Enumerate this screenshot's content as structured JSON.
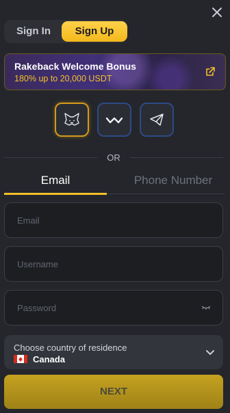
{
  "auth_tabs": {
    "sign_in": "Sign In",
    "sign_up": "Sign Up",
    "active": "Sign Up"
  },
  "bonus": {
    "title": "Rakeback Welcome Bonus",
    "subtitle": "180% up to 20,000 USDT"
  },
  "wallets": [
    "metamask-icon",
    "walletconnect-icon",
    "telegram-icon"
  ],
  "divider": {
    "text": "OR"
  },
  "method_tabs": {
    "email": "Email",
    "phone": "Phone Number",
    "active": "Email"
  },
  "form": {
    "email": {
      "placeholder": "Email",
      "value": ""
    },
    "username": {
      "placeholder": "Username",
      "value": ""
    },
    "password": {
      "placeholder": "Password",
      "value": ""
    }
  },
  "country": {
    "label": "Choose country of residence",
    "value": "Canada"
  },
  "next_label": "NEXT",
  "colors": {
    "accent": "#f3c02a",
    "background": "#24262b",
    "field_bg": "#1c1e22"
  }
}
